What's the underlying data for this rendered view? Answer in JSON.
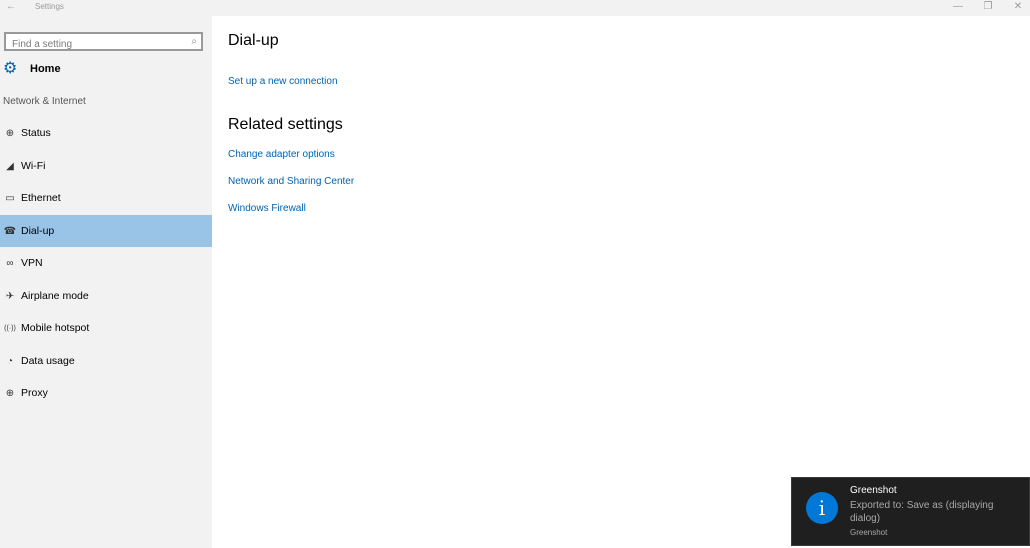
{
  "window": {
    "title": "Settings",
    "back_icon": "←",
    "minimize_icon": "—",
    "maximize_icon": "❐",
    "close_icon": "✕"
  },
  "sidebar": {
    "search": {
      "placeholder": "Find a setting",
      "value": "",
      "icon": "⌕"
    },
    "home": {
      "label": "Home",
      "icon": "⚙"
    },
    "section_label": "Network & Internet",
    "items": [
      {
        "label": "Status",
        "icon": "⊕",
        "icon_name": "status-icon",
        "active": false
      },
      {
        "label": "Wi-Fi",
        "icon": "◢",
        "icon_name": "wifi-icon",
        "active": false
      },
      {
        "label": "Ethernet",
        "icon": "▭",
        "icon_name": "ethernet-icon",
        "active": false
      },
      {
        "label": "Dial-up",
        "icon": "☎",
        "icon_name": "dialup-icon",
        "active": true
      },
      {
        "label": "VPN",
        "icon": "∞",
        "icon_name": "vpn-icon",
        "active": false
      },
      {
        "label": "Airplane mode",
        "icon": "✈",
        "icon_name": "airplane-icon",
        "active": false
      },
      {
        "label": "Mobile hotspot",
        "icon": "((·))",
        "icon_name": "hotspot-icon",
        "active": false
      },
      {
        "label": "Data usage",
        "icon": "◔",
        "icon_name": "data-usage-icon",
        "active": false
      },
      {
        "label": "Proxy",
        "icon": "⊕",
        "icon_name": "globe-icon",
        "active": false
      }
    ]
  },
  "main": {
    "title": "Dial-up",
    "setup_link": "Set up a new connection",
    "related_title": "Related settings",
    "related_links": [
      "Change adapter options",
      "Network and Sharing Center",
      "Windows Firewall"
    ]
  },
  "toast": {
    "icon": "i",
    "title": "Greenshot",
    "message": "Exported to: Save as (displaying dialog)",
    "source": "Greenshot"
  },
  "colors": {
    "accent": "#0063b1",
    "active_item": "#99c4e8",
    "toast_bg": "#1f1f1f",
    "toast_icon": "#0078d7"
  }
}
